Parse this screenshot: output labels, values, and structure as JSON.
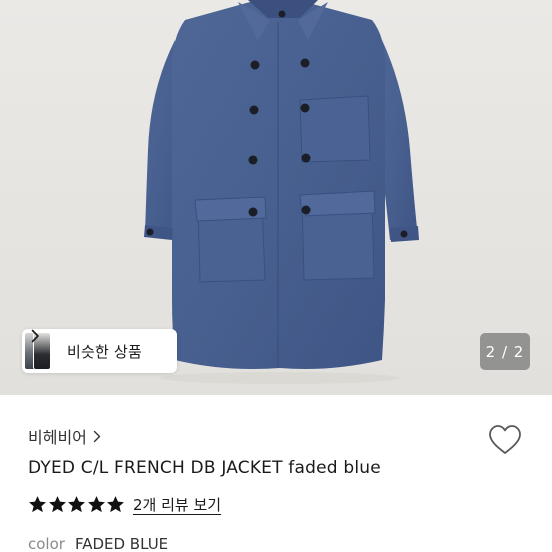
{
  "gallery": {
    "similar_label": "비슷한 상품",
    "counter": "2 / 2"
  },
  "product": {
    "seller": "비헤비어",
    "title": "DYED C/L FRENCH DB JACKET faded blue",
    "rating": 5,
    "review_link": "2개 리뷰 보기",
    "color_label": "color",
    "color_value": "FADED BLUE"
  },
  "colors": {
    "jacket": "#4a6191",
    "background": "#e7e5e2",
    "star": "#111111"
  },
  "icons": {
    "chevron": "chevron-right-icon",
    "heart": "heart-outline-icon",
    "star": "star-filled-icon"
  }
}
